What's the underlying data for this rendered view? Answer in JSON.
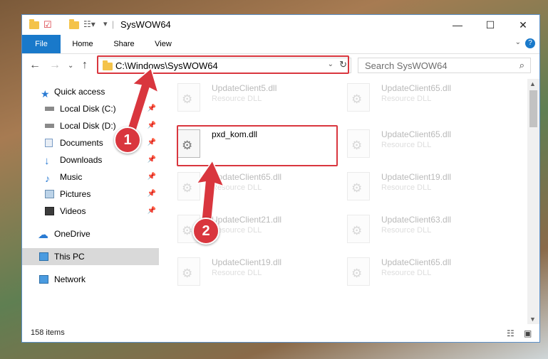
{
  "window": {
    "title": "SysWOW64",
    "controls": {
      "minimize": "—",
      "maximize": "☐",
      "close": "✕"
    }
  },
  "ribbon": {
    "tabs": [
      "File",
      "Home",
      "Share",
      "View"
    ]
  },
  "address": {
    "path": "C:\\Windows\\SysWOW64",
    "search_placeholder": "Search SysWOW64"
  },
  "nav": {
    "quick_access": "Quick access",
    "items": [
      {
        "label": "Local Disk (C:)"
      },
      {
        "label": "Local Disk (D:)"
      },
      {
        "label": "Documents"
      },
      {
        "label": "Downloads"
      },
      {
        "label": "Music"
      },
      {
        "label": "Pictures"
      },
      {
        "label": "Videos"
      }
    ],
    "onedrive": "OneDrive",
    "this_pc": "This PC",
    "network": "Network"
  },
  "files": {
    "left": [
      {
        "name": "UpdateClient5.dll",
        "type": "Resource DLL"
      },
      {
        "name": "pxd_kom.dll",
        "type": ""
      },
      {
        "name": "UpdateClient65.dll",
        "type": "Resource DLL"
      },
      {
        "name": "UpdateClient21.dll",
        "type": "Resource DLL"
      },
      {
        "name": "UpdateClient19.dll",
        "type": "Resource DLL"
      }
    ],
    "right": [
      {
        "name": "UpdateClient65.dll",
        "type": "Resource DLL"
      },
      {
        "name": "UpdateClient65.dll",
        "type": "Resource DLL"
      },
      {
        "name": "UpdateClient19.dll",
        "type": "Resource DLL"
      },
      {
        "name": "UpdateClient63.dll",
        "type": "Resource DLL"
      },
      {
        "name": "UpdateClient65.dll",
        "type": "Resource DLL"
      }
    ]
  },
  "status": {
    "item_count": "158 items"
  },
  "callouts": {
    "one": "1",
    "two": "2"
  },
  "colors": {
    "accent": "#1979ca",
    "highlight": "#d9363e"
  }
}
